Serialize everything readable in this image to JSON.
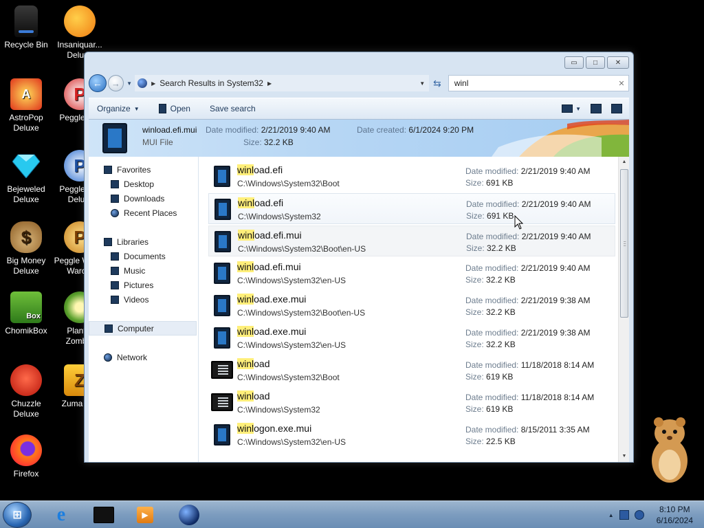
{
  "desktop": {
    "icons": [
      {
        "label": "Recycle Bin",
        "icon": "recycle-bin-icon"
      },
      {
        "label": "Insaniquar... Deluxe",
        "icon": "goldfish-icon"
      },
      {
        "label": "AstroPop Deluxe",
        "icon": "astropop-icon"
      },
      {
        "label": "Peggle D...",
        "icon": "peggle-icon"
      },
      {
        "label": "Bejeweled Deluxe",
        "icon": "diamond-icon"
      },
      {
        "label": "Peggle N... Delu...",
        "icon": "peggle-nights-icon"
      },
      {
        "label": "Big Money Deluxe",
        "icon": "money-bag-icon"
      },
      {
        "label": "Peggle W... of Warc...",
        "icon": "peggle-wow-icon"
      },
      {
        "label": "ChomikBox",
        "icon": "chomikbox-icon"
      },
      {
        "label": "Plant... Zomb...",
        "icon": "plants-vs-zombies-icon"
      },
      {
        "label": "Chuzzle Deluxe",
        "icon": "chuzzle-icon"
      },
      {
        "label": "Zuma D...",
        "icon": "zuma-icon"
      },
      {
        "label": "Firefox",
        "icon": "firefox-icon"
      }
    ]
  },
  "window": {
    "title_buttons": {
      "minimize": "▭",
      "maximize": "□",
      "close": "✕"
    },
    "address": {
      "back": "←",
      "forward": "→",
      "breadcrumb": "Search Results in System32"
    },
    "search": {
      "value": "winl"
    },
    "toolbar": {
      "organize": "Organize",
      "open": "Open",
      "save_search": "Save search"
    },
    "preview": {
      "file_name": "winload.efi.mui",
      "file_type": "MUI File",
      "date_modified_label": "Date modified:",
      "date_modified": "2/21/2019 9:40 AM",
      "size_label": "Size:",
      "size": "32.2 KB",
      "date_created_label": "Date created:",
      "date_created": "6/1/2024 9:20 PM"
    },
    "nav": {
      "favorites": "Favorites",
      "desktop": "Desktop",
      "downloads": "Downloads",
      "recent_places": "Recent Places",
      "libraries": "Libraries",
      "documents": "Documents",
      "music": "Music",
      "pictures": "Pictures",
      "videos": "Videos",
      "computer": "Computer",
      "network": "Network"
    },
    "labels": {
      "date_modified": "Date modified:",
      "size": "Size:"
    },
    "files": [
      {
        "match": "winl",
        "rest": "oad.efi",
        "path": "C:\\Windows\\System32\\Boot",
        "date": "2/21/2019 9:40 AM",
        "size": "691 KB",
        "kind": "doc"
      },
      {
        "match": "winl",
        "rest": "oad.efi",
        "path": "C:\\Windows\\System32",
        "date": "2/21/2019 9:40 AM",
        "size": "691 KB",
        "kind": "doc"
      },
      {
        "match": "winl",
        "rest": "oad.efi.mui",
        "path": "C:\\Windows\\System32\\Boot\\en-US",
        "date": "2/21/2019 9:40 AM",
        "size": "32.2 KB",
        "kind": "doc"
      },
      {
        "match": "winl",
        "rest": "oad.efi.mui",
        "path": "C:\\Windows\\System32\\en-US",
        "date": "2/21/2019 9:40 AM",
        "size": "32.2 KB",
        "kind": "doc"
      },
      {
        "match": "winl",
        "rest": "oad.exe.mui",
        "path": "C:\\Windows\\System32\\Boot\\en-US",
        "date": "2/21/2019 9:38 AM",
        "size": "32.2 KB",
        "kind": "doc"
      },
      {
        "match": "winl",
        "rest": "oad.exe.mui",
        "path": "C:\\Windows\\System32\\en-US",
        "date": "2/21/2019 9:38 AM",
        "size": "32.2 KB",
        "kind": "doc"
      },
      {
        "match": "winl",
        "rest": "oad",
        "path": "C:\\Windows\\System32\\Boot",
        "date": "11/18/2018 8:14 AM",
        "size": "619 KB",
        "kind": "exe"
      },
      {
        "match": "winl",
        "rest": "oad",
        "path": "C:\\Windows\\System32",
        "date": "11/18/2018 8:14 AM",
        "size": "619 KB",
        "kind": "exe"
      },
      {
        "match": "winl",
        "rest": "ogon.exe.mui",
        "path": "C:\\Windows\\System32\\en-US",
        "date": "8/15/2011 3:35 AM",
        "size": "22.5 KB",
        "kind": "doc"
      }
    ]
  },
  "taskbar": {
    "clock_time": "8:10 PM",
    "clock_date": "6/16/2024",
    "ie_glyph": "e",
    "wmp_glyph": "▶"
  }
}
